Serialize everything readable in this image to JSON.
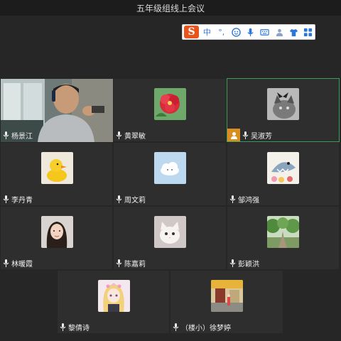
{
  "window": {
    "title": "五年级组线上会议"
  },
  "ime_toolbar": {
    "logo": "S",
    "items": [
      {
        "label": "中",
        "icon": "chinese-mode-icon"
      },
      {
        "label": "°,",
        "icon": "punctuation-icon"
      },
      {
        "label": "",
        "icon": "emoji-icon"
      },
      {
        "label": "",
        "icon": "microphone-icon"
      },
      {
        "label": "",
        "icon": "keyboard-icon"
      },
      {
        "label": "",
        "icon": "user-icon"
      },
      {
        "label": "",
        "icon": "skin-icon"
      },
      {
        "label": "",
        "icon": "grid-icon"
      }
    ]
  },
  "participants": [
    {
      "name": "杨景江",
      "avatar": "video-feed",
      "active": false
    },
    {
      "name": "黄翠敏",
      "avatar": "red-flower",
      "active": false
    },
    {
      "name": "吴淑芳",
      "avatar": "gray-cat",
      "active": true,
      "host": true
    },
    {
      "name": "李丹青",
      "avatar": "yellow-duck",
      "active": false
    },
    {
      "name": "周文莉",
      "avatar": "blue-cloud",
      "active": false
    },
    {
      "name": "邹鸿强",
      "avatar": "cartoon-shark",
      "active": false
    },
    {
      "name": "林暖霞",
      "avatar": "girl-portrait",
      "active": false
    },
    {
      "name": "陈嘉莉",
      "avatar": "white-cat",
      "active": false
    },
    {
      "name": "彭颖洪",
      "avatar": "green-trees",
      "active": false
    },
    {
      "name": "黎倩诗",
      "avatar": "anime-girl",
      "active": false
    },
    {
      "name": "（楼小）徐梦婷",
      "avatar": "street-photo",
      "active": false
    }
  ],
  "colors": {
    "background": "#262626",
    "tile": "#2e2e2e",
    "active_border": "#3f9b5c",
    "host_badge": "#d98e1f",
    "ime_accent": "#e8541e"
  }
}
